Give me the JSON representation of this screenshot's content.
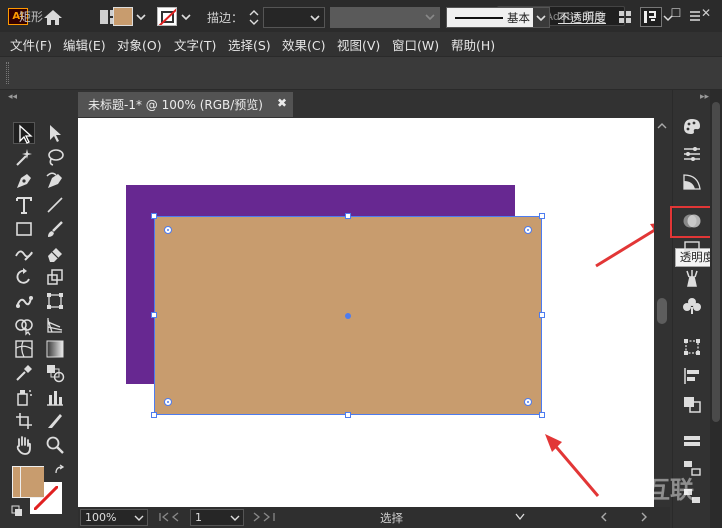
{
  "app": {
    "logo": "Ai",
    "window_controls": [
      "—",
      "☐",
      "✕"
    ]
  },
  "search": {
    "placeholder": "搜索 Adobe 帮助"
  },
  "menu": [
    "文件(F)",
    "编辑(E)",
    "对象(O)",
    "文字(T)",
    "选择(S)",
    "效果(C)",
    "视图(V)",
    "窗口(W)",
    "帮助(H)"
  ],
  "control": {
    "selection_label": "矩形",
    "fill_color": "#c89c6e",
    "stroke_label": "描边：",
    "brush_label": "基本",
    "opacity_label": "不透明度"
  },
  "document": {
    "tab_title": "未标题-1* @ 100% (RGB/预览)",
    "close_glyph": "✖"
  },
  "canvas": {
    "purple_color": "#672891",
    "tan_color": "#c89c6e",
    "selection_color": "#4d7cf0"
  },
  "status": {
    "zoom": "100%",
    "page": "1",
    "label": "选择"
  },
  "right_panel": {
    "tooltip": "透明度",
    "highlight_color": "#e23636"
  },
  "watermark": "互联"
}
